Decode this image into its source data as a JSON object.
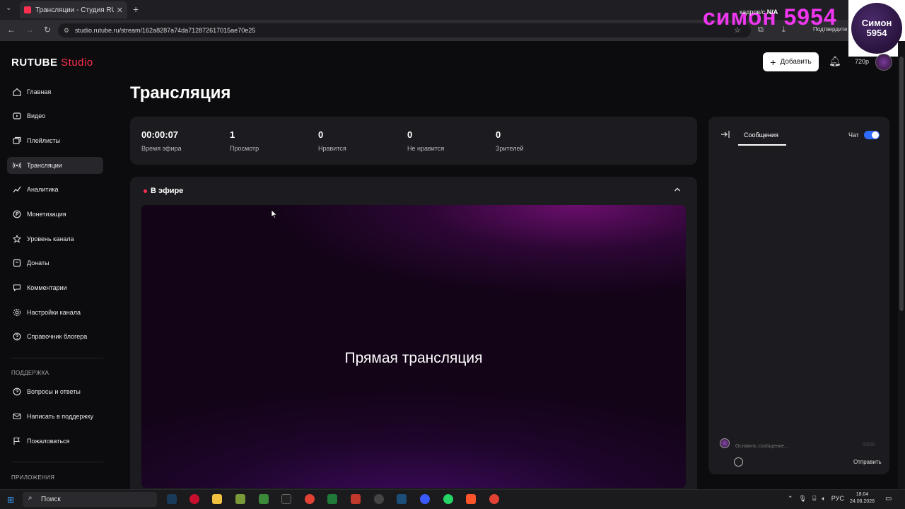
{
  "browser": {
    "tab_title": "Трансляции - Студия RUTUBE",
    "tab_close": "✕",
    "new_tab": "+",
    "url": "studio.rutube.ru/stream/162a8287a74da712872617015ae70e25",
    "confirm_label": "Подтвердите"
  },
  "overlay": {
    "fps_label": "кадров/с",
    "fps_value": "N/A",
    "big_text": "симон 5954",
    "logo_text": "Симон 5954"
  },
  "header": {
    "brand_main": "RUTUBE",
    "brand_studio": "Studio",
    "add_label": "Добавить",
    "quality": "720p"
  },
  "sidebar": {
    "items": [
      {
        "label": "Главная",
        "icon": "home-icon"
      },
      {
        "label": "Видео",
        "icon": "video-icon"
      },
      {
        "label": "Плейлисты",
        "icon": "playlist-icon"
      },
      {
        "label": "Трансляции",
        "icon": "broadcast-icon",
        "active": true
      },
      {
        "label": "Аналитика",
        "icon": "analytics-icon"
      },
      {
        "label": "Монетизация",
        "icon": "monetization-icon"
      },
      {
        "label": "Уровень канала",
        "icon": "level-icon"
      },
      {
        "label": "Донаты",
        "icon": "donations-icon"
      },
      {
        "label": "Комментарии",
        "icon": "comments-icon"
      },
      {
        "label": "Настройки канала",
        "icon": "settings-icon"
      },
      {
        "label": "Справочник блогера",
        "icon": "handbook-icon"
      }
    ],
    "support_label": "ПОДДЕРЖКА",
    "support_items": [
      {
        "label": "Вопросы и ответы",
        "icon": "faq-icon"
      },
      {
        "label": "Написать в поддержку",
        "icon": "mail-icon"
      },
      {
        "label": "Пожаловаться",
        "icon": "flag-icon"
      }
    ],
    "apps_label": "ПРИЛОЖЕНИЯ"
  },
  "main": {
    "title": "Трансляция",
    "stats": [
      {
        "value": "00:00:07",
        "label": "Время эфира"
      },
      {
        "value": "1",
        "label": "Просмотр"
      },
      {
        "value": "0",
        "label": "Нравится"
      },
      {
        "value": "0",
        "label": "Не нравится"
      },
      {
        "value": "0",
        "label": "Зрителей"
      }
    ],
    "live_label": "В эфире",
    "player_text": "Прямая трансляция"
  },
  "chat": {
    "tab_label": "Сообщения",
    "toggle_label": "Чат",
    "toggle_on": true,
    "input_placeholder": "Оставить сообщение...",
    "char_count": "0/200",
    "send_label": "Отправить"
  },
  "taskbar": {
    "search_label": "Поиск",
    "lang": "РУС",
    "time": "18:04",
    "date": "24.08.2026"
  },
  "colors": {
    "accent": "#ff2f4f",
    "toggle": "#2f6bff",
    "overlay_text": "#ff38ff"
  }
}
